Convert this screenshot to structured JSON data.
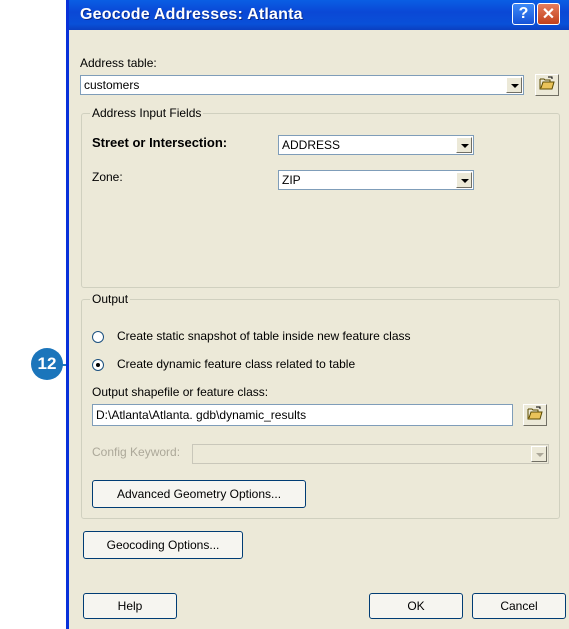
{
  "callout": {
    "number": "12"
  },
  "window": {
    "title": "Geocode Addresses:  Atlanta",
    "help_button": "?",
    "close_button": "✕"
  },
  "address_table": {
    "label": "Address table:",
    "value": "customers",
    "browse_icon": "folder-open-icon"
  },
  "input_fields": {
    "group_title": "Address Input Fields",
    "street_label": "Street or Intersection:",
    "street_value": "ADDRESS",
    "zone_label": "Zone:",
    "zone_value": "ZIP"
  },
  "output": {
    "group_title": "Output",
    "radio_static": "Create static snapshot of table inside new feature class",
    "radio_dynamic": "Create dynamic feature class related to table",
    "selected": "dynamic",
    "shapefile_label": "Output shapefile or feature class:",
    "shapefile_value": "D:\\Atlanta\\Atlanta. gdb\\dynamic_results",
    "config_label": "Config Keyword:",
    "config_value": "",
    "advanced_button": "Advanced Geometry Options..."
  },
  "geocoding_button": "Geocoding Options...",
  "footer": {
    "help": "Help",
    "ok": "OK",
    "cancel": "Cancel"
  },
  "colors": {
    "titlebar": "#0a48d6",
    "dialog_bg": "#ece9d8",
    "callout": "#1b75bb"
  }
}
